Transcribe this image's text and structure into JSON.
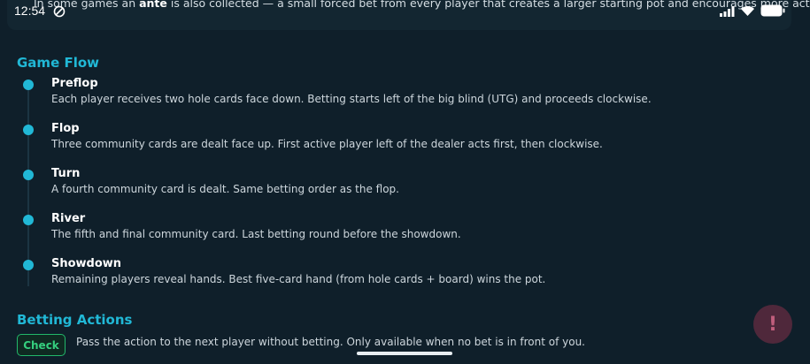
{
  "status_bar": {
    "time": "12:54",
    "icons": [
      "dnd-icon",
      "signal-icon",
      "wifi-icon",
      "battery-icon"
    ]
  },
  "intro": {
    "text_before": "In some games an ",
    "bold": "ante",
    "text_after": " is also collected — a small forced bet from every player that creates a larger starting pot and encourages more action."
  },
  "game_flow": {
    "title": "Game Flow",
    "steps": [
      {
        "title": "Preflop",
        "desc": "Each player receives two hole cards face down. Betting starts left of the big blind (UTG) and proceeds clockwise."
      },
      {
        "title": "Flop",
        "desc": "Three community cards are dealt face up. First active player left of the dealer acts first, then clockwise."
      },
      {
        "title": "Turn",
        "desc": "A fourth community card is dealt. Same betting order as the flop."
      },
      {
        "title": "River",
        "desc": "The fifth and final community card. Last betting round before the showdown."
      },
      {
        "title": "Showdown",
        "desc": "Remaining players reveal hands. Best five-card hand (from hole cards + board) wins the pot."
      }
    ]
  },
  "betting_actions": {
    "title": "Betting Actions",
    "items": [
      {
        "badge": "Check",
        "desc": "Pass the action to the next player without betting. Only available when no bet is in front of you."
      }
    ]
  },
  "fab": {
    "label": "!"
  },
  "colors": {
    "accent": "#21b8d6",
    "check": "#35d07f",
    "background": "#0f1f2a"
  }
}
